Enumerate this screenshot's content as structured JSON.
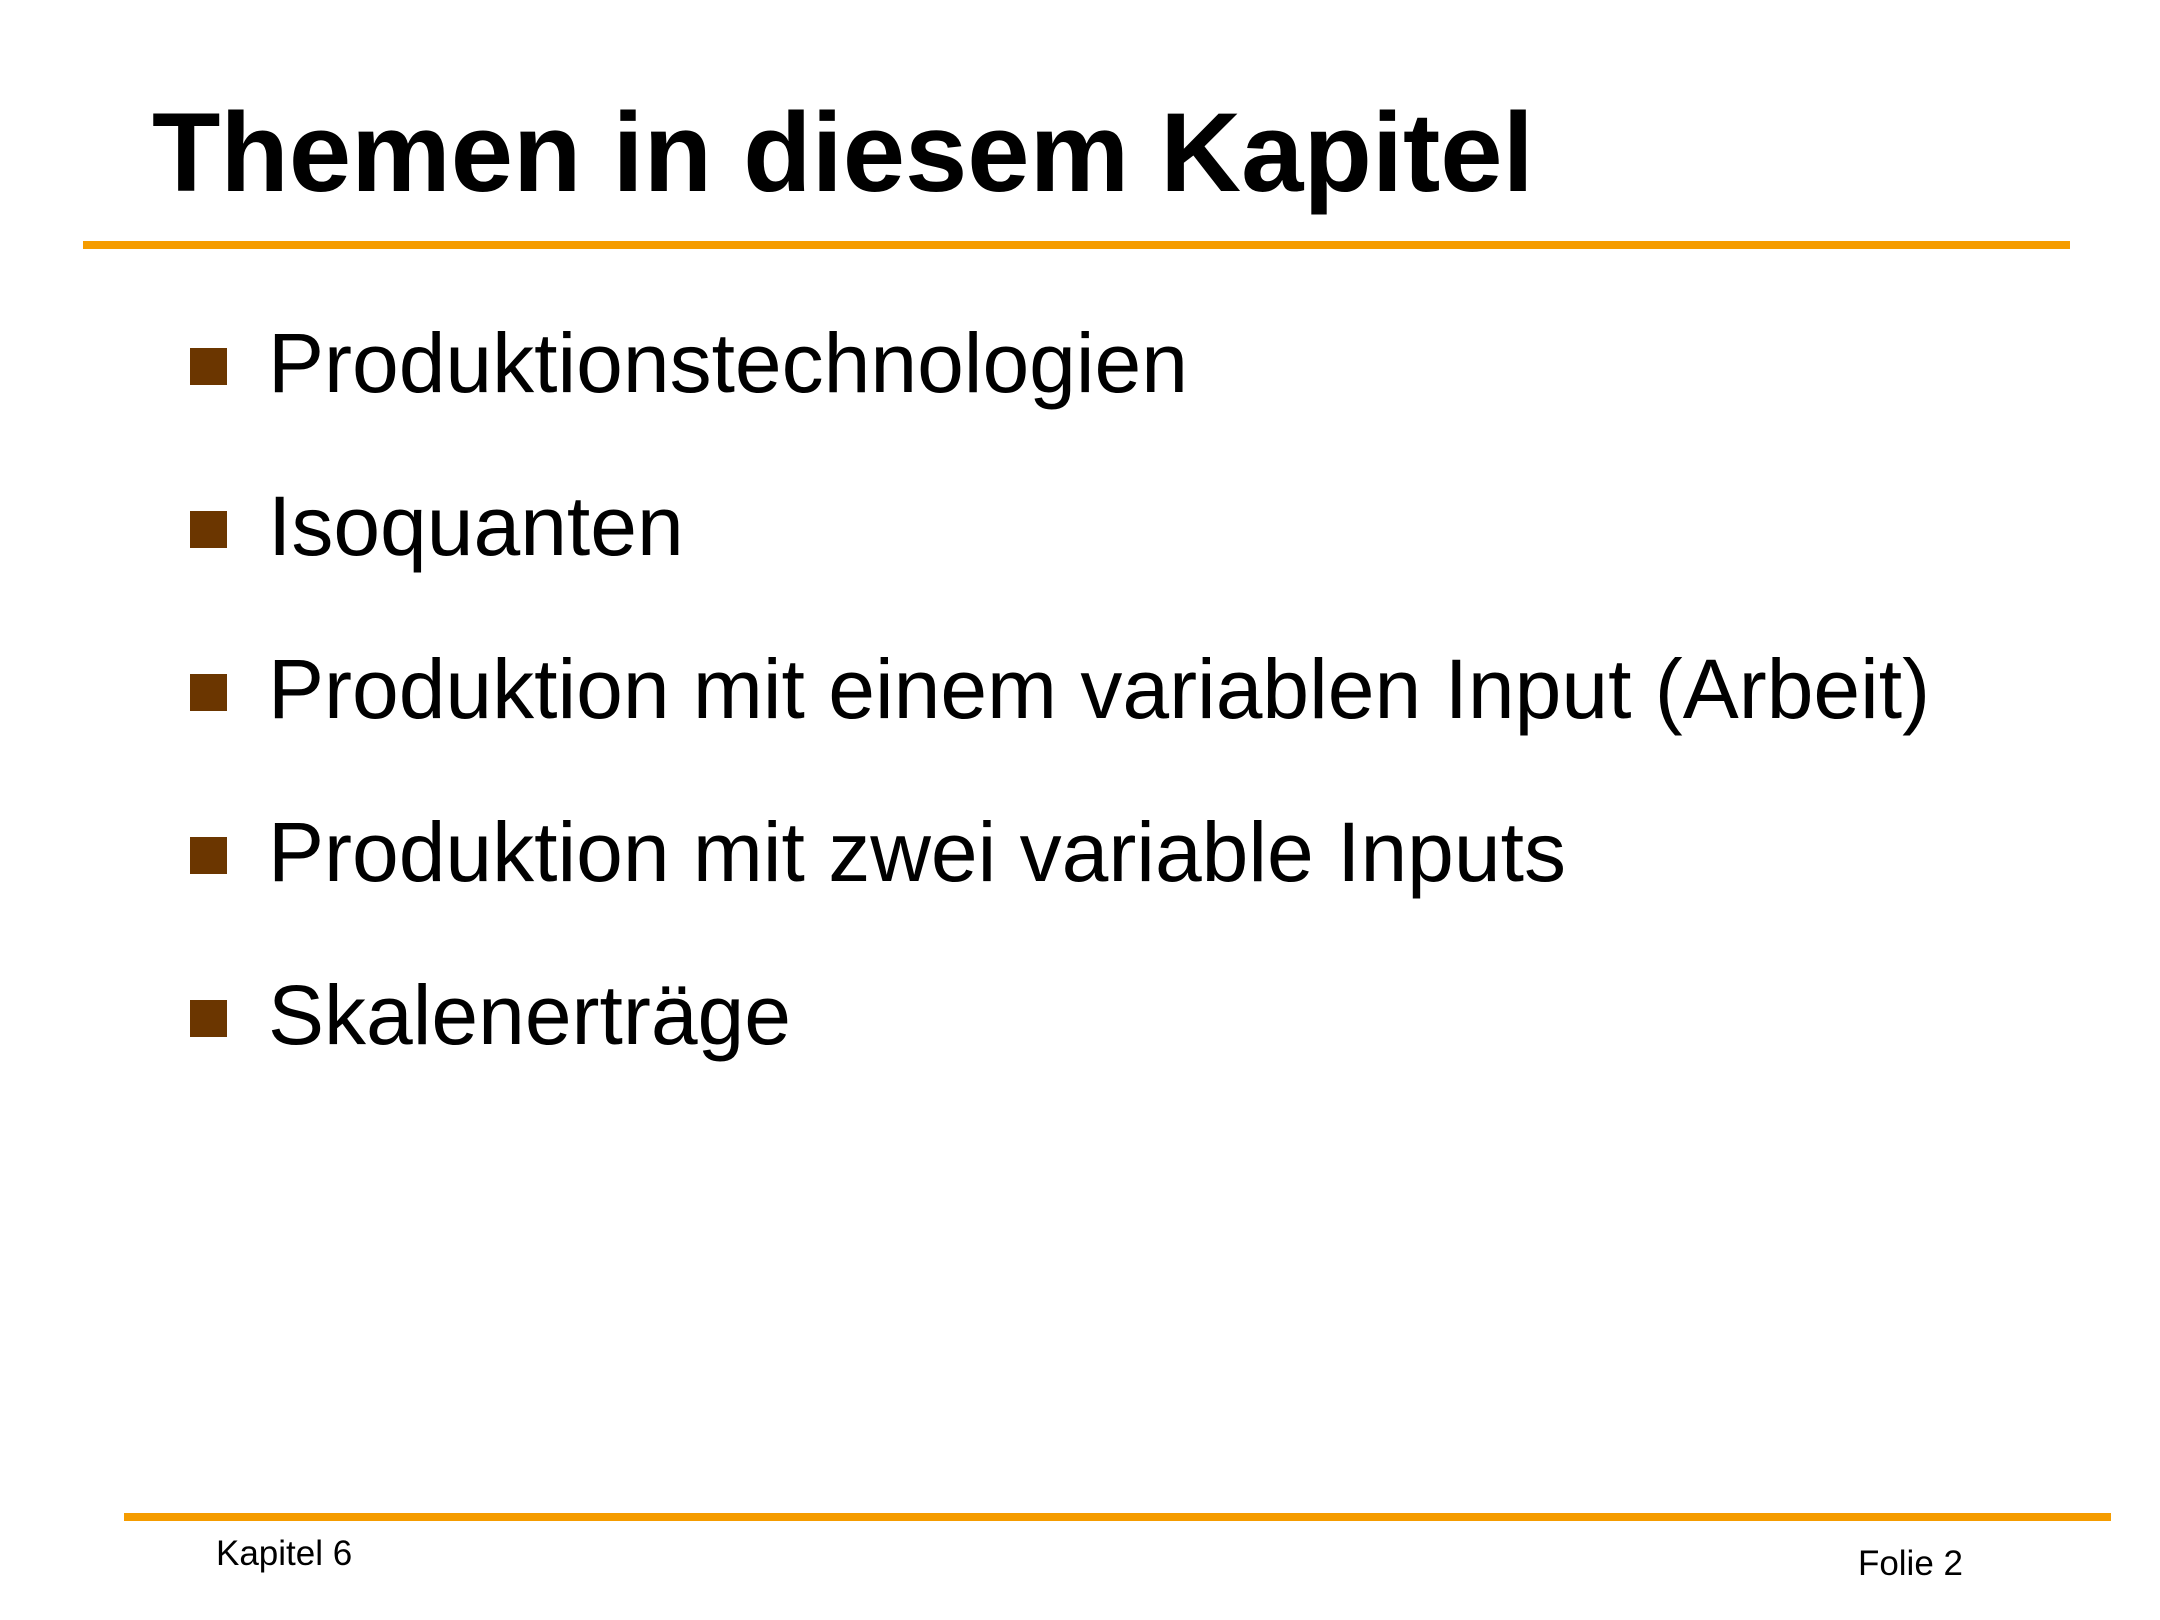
{
  "slide": {
    "title": "Themen in diesem Kapitel",
    "bullets": [
      "Produktionstechnologien",
      "Isoquanten",
      "Produktion mit einem variablen Input (Arbeit)",
      "Produktion mit zwei variable Inputs",
      "Skalenerträge"
    ],
    "footer": {
      "chapter": "Kapitel 6",
      "slide_number": "Folie 2"
    }
  },
  "colors": {
    "accent_rule": "#F59C00",
    "bullet_marker": "#6B3600",
    "text": "#000000",
    "background": "#FFFFFF"
  }
}
